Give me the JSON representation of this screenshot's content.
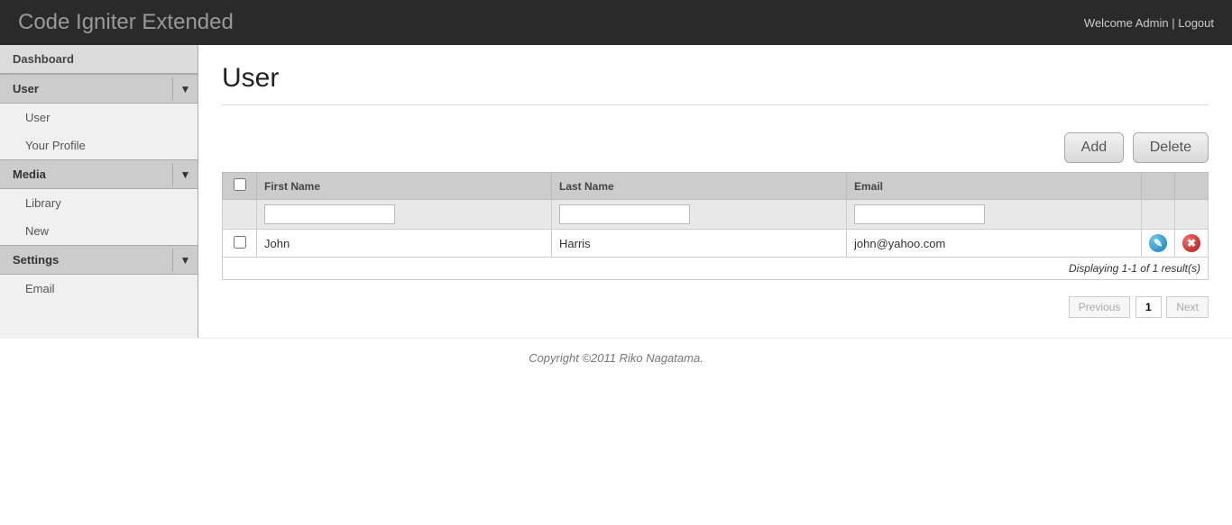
{
  "header": {
    "title": "Code Igniter Extended",
    "welcome": "Welcome Admin",
    "logout": "Logout"
  },
  "sidebar": {
    "dashboard": "Dashboard",
    "sections": [
      {
        "label": "User",
        "items": [
          "User",
          "Your Profile"
        ]
      },
      {
        "label": "Media",
        "items": [
          "Library",
          "New"
        ]
      },
      {
        "label": "Settings",
        "items": [
          "Email"
        ]
      }
    ]
  },
  "page": {
    "title": "User"
  },
  "buttons": {
    "add": "Add",
    "delete": "Delete"
  },
  "table": {
    "columns": {
      "first_name": "First Name",
      "last_name": "Last Name",
      "email": "Email"
    },
    "rows": [
      {
        "first_name": "John",
        "last_name": "Harris",
        "email": "john@yahoo.com"
      }
    ],
    "footer": "Displaying 1-1 of 1 result(s)"
  },
  "pager": {
    "previous": "Previous",
    "current": "1",
    "next": "Next"
  },
  "footer": "Copyright ©2011 Riko Nagatama."
}
